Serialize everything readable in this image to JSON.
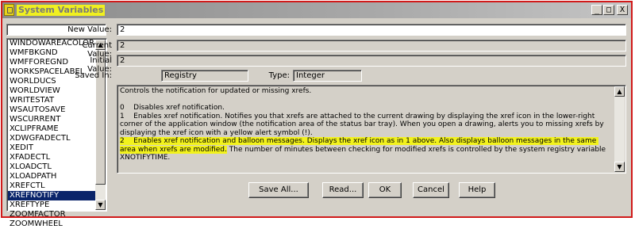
{
  "window": {
    "title": "System Variables",
    "minimize": "_",
    "maximize": "□",
    "close": "X"
  },
  "search": {
    "value": ""
  },
  "variables": [
    "WINDOWAREACOLOR",
    "WMFBKGND",
    "WMFFOREGND",
    "WORKSPACELABEL",
    "WORLDUCS",
    "WORLDVIEW",
    "WRITESTAT",
    "WSAUTOSAVE",
    "WSCURRENT",
    "XCLIPFRAME",
    "XDWGFADECTL",
    "XEDIT",
    "XFADECTL",
    "XLOADCTL",
    "XLOADPATH",
    "XREFCTL",
    "XREFNOTIFY",
    "XREFTYPE",
    "ZOOMFACTOR",
    "ZOOMWHEEL"
  ],
  "selected_variable": "XREFNOTIFY",
  "fields": {
    "new_value_label": "New Value:",
    "new_value": "2",
    "current_value_label": "Current Value:",
    "current_value": "2",
    "initial_value_label": "Initial Value:",
    "initial_value": "2",
    "saved_in_label": "Saved In:",
    "saved_in": "Registry",
    "type_label": "Type:",
    "type": "Integer"
  },
  "description": {
    "intro": "Controls the notification for updated or missing xrefs.",
    "opt0": "0    Disables xref notification.",
    "opt1": "1    Enables xref notification. Notifies you that xrefs are attached to the current drawing by displaying the xref icon in the lower-right corner of the application window (the notification area of the status bar tray). When you open a drawing, alerts you to missing xrefs by displaying the xref icon with a yellow alert symbol (!).",
    "opt2_a": "2    Enables xref notification and balloon messages. Displays the xref icon as in 1 above. ",
    "opt2_b": "Also displays balloon messages in the same area when xrefs are modified.",
    "opt2_c": " The number of minutes between checking for modified xrefs is controlled by the system registry variable XNOTIFYTIME."
  },
  "buttons": {
    "save_all": "Save All...",
    "read": "Read...",
    "ok": "OK",
    "cancel": "Cancel",
    "help": "Help"
  },
  "colors": {
    "highlight": "#f2f21c",
    "selection": "#0a246a",
    "window_border": "#d11a1a"
  }
}
